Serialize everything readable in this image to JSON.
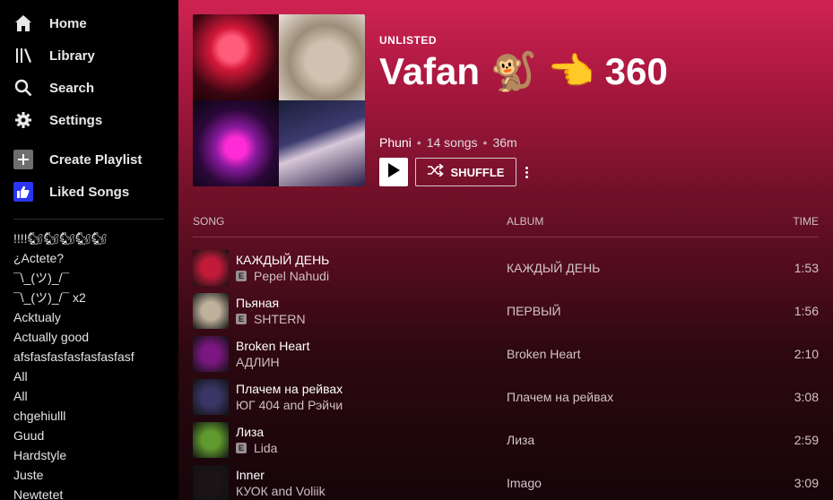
{
  "sidebar": {
    "nav": [
      {
        "label": "Home",
        "icon": "home-icon"
      },
      {
        "label": "Library",
        "icon": "library-icon"
      },
      {
        "label": "Search",
        "icon": "search-icon"
      },
      {
        "label": "Settings",
        "icon": "gear-icon"
      }
    ],
    "create_playlist": {
      "label": "Create Playlist",
      "icon": "plus-icon"
    },
    "liked_songs": {
      "label": "Liked Songs",
      "icon": "thumbs-up-icon"
    },
    "playlists": [
      "!!!!🐿🐿🐿🐿🐿",
      "¿Actete?",
      "¯\\_(ツ)_/¯",
      "¯\\_(ツ)_/¯ x2",
      "Acktualy",
      "Actually good",
      "afsfasfasfasfasfasfasf",
      "All",
      "All",
      "chgehiulll",
      "Guud",
      "Hardstyle",
      "Juste",
      "Newtetet"
    ]
  },
  "playlist": {
    "visibility": "UNLISTED",
    "title": "Vafan 🐒 👈 360",
    "owner": "Phuni",
    "song_count": "14 songs",
    "duration": "36m",
    "shuffle_label": "SHUFFLE"
  },
  "table": {
    "headers": {
      "song": "SONG",
      "album": "ALBUM",
      "time": "TIME"
    },
    "rows": [
      {
        "title": "КАЖДЫЙ ДЕНЬ",
        "artist": "Pepel Nahudi",
        "explicit": true,
        "album": "КАЖДЫЙ ДЕНЬ",
        "time": "1:53",
        "art": "#c21b3a"
      },
      {
        "title": "Пьяная",
        "artist": "SHTERN",
        "explicit": true,
        "album": "ПЕРВЫЙ",
        "time": "1:56",
        "art": "#bfb19c"
      },
      {
        "title": "Broken Heart",
        "artist": "АДЛИН",
        "explicit": false,
        "album": "Broken Heart",
        "time": "2:10",
        "art": "#7a1780"
      },
      {
        "title": "Плачем на рейвах",
        "artist": "ЮГ 404 and Рэйчи",
        "explicit": false,
        "album": "Плачем на рейвах",
        "time": "3:08",
        "art": "#3a3566"
      },
      {
        "title": "Лиза",
        "artist": "Lida",
        "explicit": true,
        "album": "Лиза",
        "time": "2:59",
        "art": "#5f9a2e"
      },
      {
        "title": "Inner",
        "artist": "КУОК and Voliik",
        "explicit": false,
        "album": "Imago",
        "time": "3:09",
        "art": "#1c1418"
      }
    ]
  },
  "explicit_mark": "E"
}
